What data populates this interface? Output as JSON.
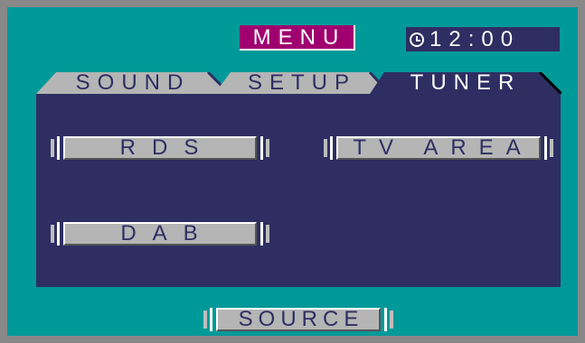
{
  "header": {
    "menu_title": "MENU",
    "clock_time": "12:00",
    "clock_icon": "clock-icon"
  },
  "tabs": [
    {
      "label": "SOUND",
      "active": false
    },
    {
      "label": "SETUP",
      "active": false
    },
    {
      "label": "TUNER",
      "active": true
    }
  ],
  "tuner_panel": {
    "buttons": [
      {
        "label": "RDS"
      },
      {
        "label": "TV AREA"
      },
      {
        "label": "DAB"
      }
    ]
  },
  "footer": {
    "source_label": "SOURCE"
  },
  "colors": {
    "bezel": "#888888",
    "screen_bg": "#009999",
    "panel_bg": "#2e2e63",
    "menu_bg": "#a0006f",
    "button_face": "#b5b5b5",
    "inactive_tab": "#b5b5b5",
    "active_tab": "#2e2e63"
  }
}
